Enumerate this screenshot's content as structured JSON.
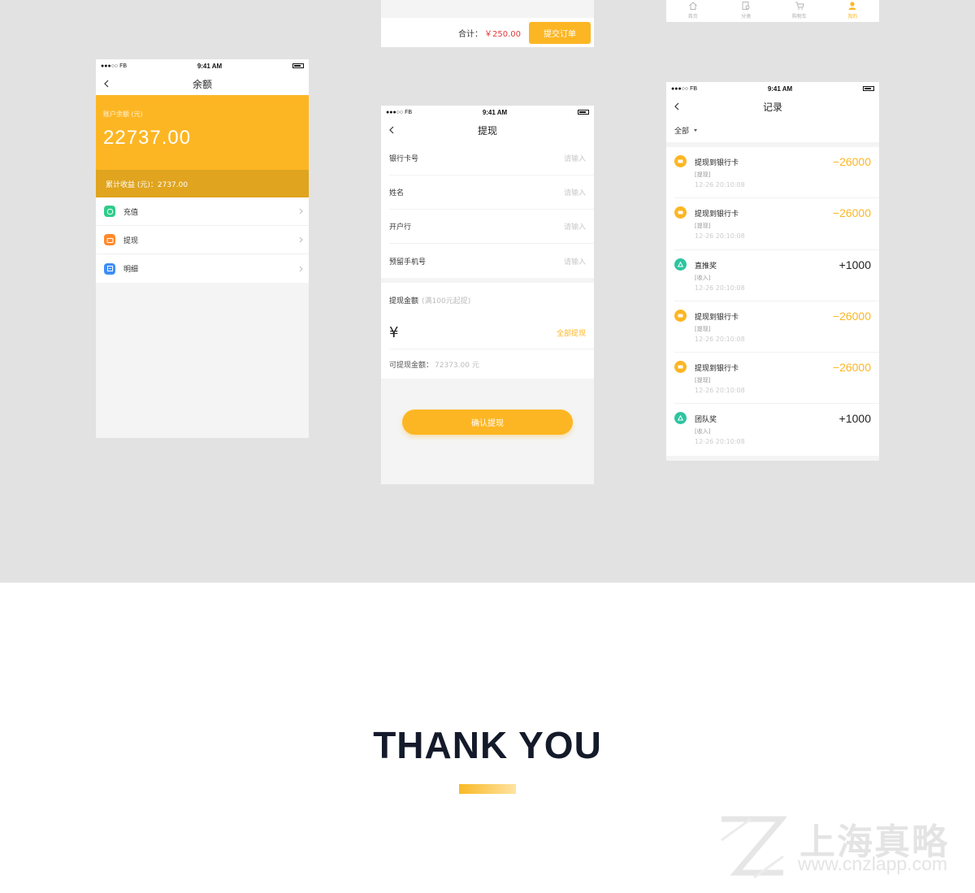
{
  "status_bar": {
    "carrier": "●●●○○ FB",
    "time": "9:41 AM"
  },
  "cart_bar": {
    "total_label": "合计：",
    "total_value": "￥250.00",
    "submit_label": "提交订单"
  },
  "tab_bar": {
    "tabs": [
      "首页",
      "分类",
      "购物车",
      "我的"
    ],
    "active": "我的"
  },
  "balance_screen": {
    "title": "余额",
    "account_label": "账户余额 (元)",
    "amount": "22737.00",
    "earnings": "累计收益 (元)：2737.00",
    "menu": [
      {
        "label": "充值",
        "icon": "recharge-icon",
        "color": "#2ecc8a"
      },
      {
        "label": "提现",
        "icon": "withdraw-icon",
        "color": "#ff8a2b"
      },
      {
        "label": "明细",
        "icon": "detail-icon",
        "color": "#3e8ef7"
      }
    ]
  },
  "withdraw_screen": {
    "title": "提现",
    "fields": [
      {
        "label": "银行卡号",
        "placeholder": "请输入"
      },
      {
        "label": "姓名",
        "placeholder": "请输入"
      },
      {
        "label": "开户行",
        "placeholder": "请输入"
      },
      {
        "label": "预留手机号",
        "placeholder": "请输入"
      }
    ],
    "amount_label": "提现金额",
    "amount_hint": "(满100元起提)",
    "currency": "¥",
    "withdraw_all": "全部提现",
    "available_label": "可提现金额：",
    "available_value": "72373.00 元",
    "confirm": "确认提现"
  },
  "records_screen": {
    "title": "记录",
    "filter": "全部",
    "items": [
      {
        "title": "提现到银行卡",
        "tag": "[提现]",
        "time": "12-26  20:10:08",
        "amount": "−26000",
        "type": "neg"
      },
      {
        "title": "提现到银行卡",
        "tag": "[提现]",
        "time": "12-26  20:10:08",
        "amount": "−26000",
        "type": "neg"
      },
      {
        "title": "直推奖",
        "tag": "[收入]",
        "time": "12-26  20:10:08",
        "amount": "+1000",
        "type": "pos"
      },
      {
        "title": "提现到银行卡",
        "tag": "[提现]",
        "time": "12-26  20:10:08",
        "amount": "−26000",
        "type": "neg"
      },
      {
        "title": "提现到银行卡",
        "tag": "[提现]",
        "time": "12-26  20:10:08",
        "amount": "−26000",
        "type": "neg"
      },
      {
        "title": "团队奖",
        "tag": "[收入]",
        "time": "12-26  20:10:08",
        "amount": "+1000",
        "type": "pos"
      }
    ]
  },
  "footer": {
    "thanks": "THANK YOU",
    "watermark_name": "上海真略",
    "watermark_url": "www.cnzlapp.com"
  },
  "colors": {
    "accent": "#fdb623",
    "price_red": "#e23b3b",
    "income_green": "#2ec4a0"
  }
}
